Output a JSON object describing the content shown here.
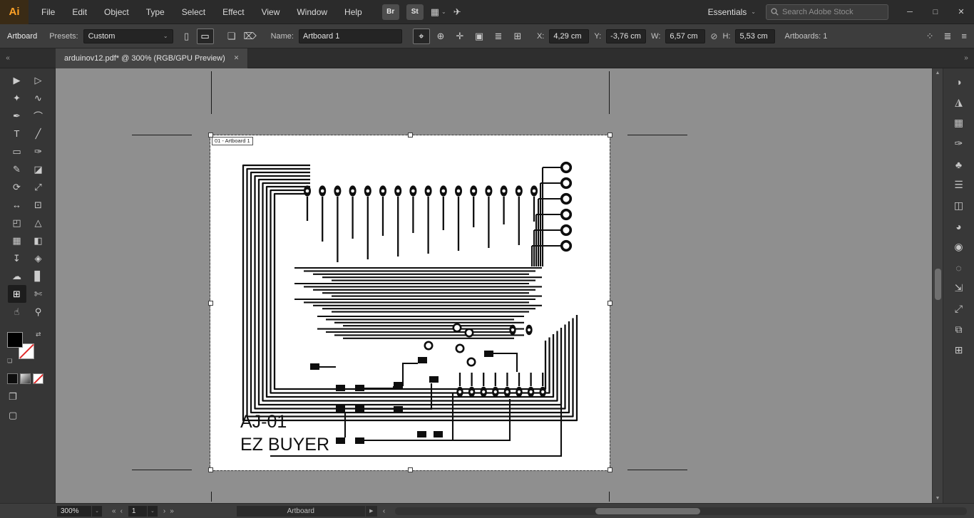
{
  "colors": {
    "ui_dark": "#2b2b2b",
    "ui_mid": "#3d3d3d",
    "canvas_bg": "#8f8f8f",
    "logo_bg": "#3a2b15",
    "logo_text": "#ffa226",
    "input_bg": "#242424",
    "trace_black": "#0e0e0e",
    "none_red": "#e02a2a"
  },
  "icons": {
    "chevron_down": "⌄",
    "double_left": "«",
    "double_right": "»",
    "prev": "‹",
    "next": "›",
    "arrow_up": "▲",
    "arrow_down": "▼",
    "arrow_right": "▶",
    "minimize": "─",
    "maximize": "□",
    "close": "✕",
    "no_link": "⊘",
    "swap": "⇄",
    "default_swatches": "❏",
    "share": "✈",
    "arrange_documents": "▦"
  },
  "menubar": {
    "logo_text": "Ai",
    "items": [
      {
        "name": "menu-item-file",
        "label": "File"
      },
      {
        "name": "menu-item-edit",
        "label": "Edit"
      },
      {
        "name": "menu-item-object",
        "label": "Object"
      },
      {
        "name": "menu-item-type",
        "label": "Type"
      },
      {
        "name": "menu-item-select",
        "label": "Select"
      },
      {
        "name": "menu-item-effect",
        "label": "Effect"
      },
      {
        "name": "menu-item-view",
        "label": "View"
      },
      {
        "name": "menu-item-window",
        "label": "Window"
      },
      {
        "name": "menu-item-help",
        "label": "Help"
      }
    ],
    "bridge_button": "Br",
    "stock_button": "St",
    "workspace_label": "Essentials",
    "search_placeholder": "Search Adobe Stock"
  },
  "control_bar": {
    "panel_label": "Artboard",
    "presets_label": "Presets:",
    "presets_value": "Custom",
    "orientation": [
      {
        "name": "portrait-orientation-icon",
        "glyph": "▯"
      },
      {
        "name": "landscape-orientation-icon",
        "glyph": "▭",
        "state": "selected"
      }
    ],
    "pre_name_icons": [
      {
        "name": "move-artwork-icon",
        "glyph": "❏"
      },
      {
        "name": "delete-artboard-icon",
        "glyph": "⌦"
      }
    ],
    "name_label": "Name:",
    "name_value": "Artboard 1",
    "artboard_icons": [
      {
        "name": "move-copy-artwork-toggle",
        "glyph": "⌖",
        "state": "selected"
      },
      {
        "name": "show-center-mark-icon",
        "glyph": "⊕"
      },
      {
        "name": "show-cross-hairs-icon",
        "glyph": "✛"
      },
      {
        "name": "show-video-safe-areas-icon",
        "glyph": "▣"
      },
      {
        "name": "artboard-options-icon",
        "glyph": "≣"
      },
      {
        "name": "rearrange-artboards-icon",
        "glyph": "⊞"
      }
    ],
    "x_label": "X:",
    "x_value": "4,29 cm",
    "y_label": "Y:",
    "y_value": "-3,76 cm",
    "w_label": "W:",
    "w_value": "6,57 cm",
    "h_label": "H:",
    "h_value": "5,53 cm",
    "artboards_count_label": "Artboards: 1",
    "right_icons": [
      {
        "name": "dots-grid-icon",
        "glyph": "⁘"
      },
      {
        "name": "flow-options-icon",
        "glyph": "≣"
      },
      {
        "name": "panel-menu-icon",
        "glyph": "≡"
      }
    ]
  },
  "document_tab": {
    "title": "arduinov12.pdf* @ 300% (RGB/GPU Preview)"
  },
  "toolbar": {
    "tools": [
      {
        "name": "selection-tool",
        "glyph": "▶"
      },
      {
        "name": "direct-selection-tool",
        "glyph": "▷"
      },
      {
        "name": "magic-wand-tool",
        "glyph": "✦"
      },
      {
        "name": "lasso-tool",
        "glyph": "∿"
      },
      {
        "name": "pen-tool",
        "glyph": "✒"
      },
      {
        "name": "curvature-tool",
        "glyph": "⌒"
      },
      {
        "name": "type-tool",
        "glyph": "T"
      },
      {
        "name": "line-segment-tool",
        "glyph": "╱"
      },
      {
        "name": "rectangle-tool",
        "glyph": "▭"
      },
      {
        "name": "paintbrush-tool",
        "glyph": "✑"
      },
      {
        "name": "shaper-tool",
        "glyph": "✎"
      },
      {
        "name": "eraser-tool",
        "glyph": "◪"
      },
      {
        "name": "rotate-tool",
        "glyph": "⟳"
      },
      {
        "name": "scale-tool",
        "glyph": "⤢"
      },
      {
        "name": "width-tool",
        "glyph": "↔"
      },
      {
        "name": "free-transform-tool",
        "glyph": "⊡"
      },
      {
        "name": "shape-builder-tool",
        "glyph": "◰"
      },
      {
        "name": "perspective-grid-tool",
        "glyph": "△"
      },
      {
        "name": "mesh-tool",
        "glyph": "▦"
      },
      {
        "name": "gradient-tool",
        "glyph": "◧"
      },
      {
        "name": "eyedropper-tool",
        "glyph": "↧"
      },
      {
        "name": "blend-tool",
        "glyph": "◈"
      },
      {
        "name": "symbol-sprayer-tool",
        "glyph": "☁"
      },
      {
        "name": "column-graph-tool",
        "glyph": "▊"
      },
      {
        "name": "artboard-tool",
        "glyph": "⊞",
        "state": "selected"
      },
      {
        "name": "slice-tool",
        "glyph": "✄"
      },
      {
        "name": "hand-tool",
        "glyph": "☝"
      },
      {
        "name": "zoom-tool",
        "glyph": "⚲"
      }
    ]
  },
  "right_panel": {
    "icons": [
      {
        "name": "color-panel-icon",
        "glyph": "◑"
      },
      {
        "name": "color-guide-panel-icon",
        "glyph": "◮"
      },
      {
        "name": "swatches-panel-icon",
        "glyph": "▦"
      },
      {
        "name": "brushes-panel-icon",
        "glyph": "✑"
      },
      {
        "name": "symbols-panel-icon",
        "glyph": "♣"
      },
      {
        "name": "stroke-panel-icon",
        "glyph": "☰"
      },
      {
        "name": "gradient-panel-icon",
        "glyph": "◫"
      },
      {
        "name": "transparency-panel-icon",
        "glyph": "◕"
      },
      {
        "name": "appearance-panel-icon",
        "glyph": "◉"
      },
      {
        "name": "graphic-styles-panel-icon",
        "glyph": "◌"
      },
      {
        "name": "asset-export-panel-icon",
        "glyph": "⇲"
      },
      {
        "name": "navigator-panel-icon",
        "glyph": "⤢"
      },
      {
        "name": "layers-panel-icon",
        "glyph": "⧉"
      },
      {
        "name": "artboards-panel-icon",
        "glyph": "⊞"
      }
    ]
  },
  "canvas": {
    "artboard_label": "01 - Artboard 1",
    "artwork": {
      "line1": "AJ-01",
      "line2": "EZ BUYER"
    }
  },
  "statusbar": {
    "zoom_value": "300%",
    "artboard_number": "1",
    "status_display": "Artboard"
  }
}
